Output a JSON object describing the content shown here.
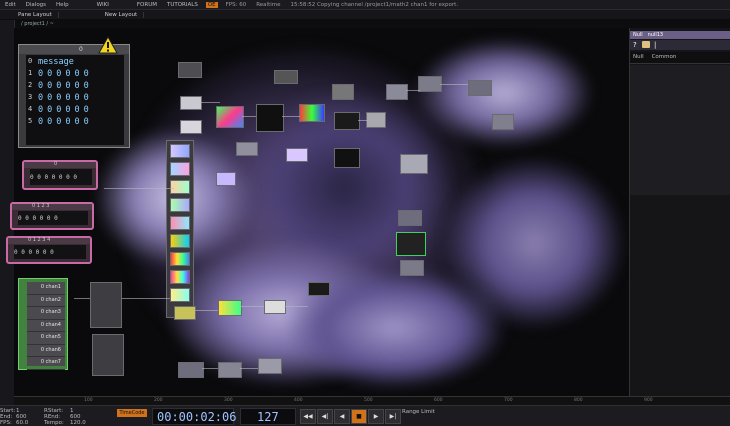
{
  "menubar": {
    "items": [
      "Edit",
      "Dialogs",
      "Help",
      "WIKI",
      "FORUM",
      "TUTORIALS"
    ],
    "perform_label": "OE",
    "fps": "FPS: 60",
    "realtime": "Realtime",
    "status": "15:58:52 Copying channel /project1/math2 chan1 for export."
  },
  "tabbar": {
    "paneLayout": "Pane Layout",
    "newLayout": "New Layout"
  },
  "path": {
    "text": "/ project1 / ~"
  },
  "table_dat": {
    "header": "0",
    "rows": [
      {
        "index": "0",
        "cells": [
          "message"
        ]
      },
      {
        "index": "1",
        "cells": [
          "0",
          "0",
          "0",
          "0",
          "0",
          "0"
        ]
      },
      {
        "index": "2",
        "cells": [
          "0",
          "0",
          "0",
          "0",
          "0",
          "0"
        ]
      },
      {
        "index": "3",
        "cells": [
          "0",
          "0",
          "0",
          "0",
          "0",
          "0"
        ]
      },
      {
        "index": "4",
        "cells": [
          "0",
          "0",
          "0",
          "0",
          "0",
          "0"
        ]
      },
      {
        "index": "5",
        "cells": [
          "0",
          "0",
          "0",
          "0",
          "0",
          "0"
        ]
      }
    ]
  },
  "chop_boxes": [
    {
      "header": "0",
      "values": "0 0 0 0 0 0 0"
    },
    {
      "header": "0 1 2 3",
      "values": "0 0 0 0 0 0"
    },
    {
      "header": "0 1 2 3 4",
      "values": "0 0 0 0 0 0"
    }
  ],
  "green_panel": {
    "items": [
      "0 chan1",
      "0 chan2",
      "0 chan3",
      "0 chan4",
      "0 chan5",
      "0 chan6",
      "0 chan7"
    ]
  },
  "param": {
    "type_label": "Null",
    "name": "null13",
    "help_icon": "question-icon",
    "tabs": [
      "Null",
      "Common"
    ]
  },
  "timeline": {
    "ticks": [
      "100",
      "200",
      "300",
      "400",
      "500",
      "600",
      "700",
      "800",
      "900"
    ]
  },
  "bottom": {
    "start_label": "Start:",
    "start_value": "1",
    "end_label": "End:",
    "end_value": "600",
    "rstart_label": "RStart:",
    "rstart_value": "1",
    "rend_label": "REnd:",
    "rend_value": "600",
    "fps_label": "FPS:",
    "fps_value": "60.0",
    "tempo_label": "Tempo:",
    "tempo_value": "120.0",
    "timecode_button": "TimeCode",
    "timecode": "00:00:02:06",
    "frame": "127",
    "range_label": "Range Limit",
    "transport": [
      "◀◀",
      "◀|",
      "◀",
      "■",
      "▶",
      "▶|"
    ]
  },
  "colors": {
    "accent_orange": "#d0721a",
    "table_text": "#8ad0ff",
    "chop_border": "#c86aa5",
    "green_panel": "#41823f",
    "param_header": "#6b5f86"
  }
}
